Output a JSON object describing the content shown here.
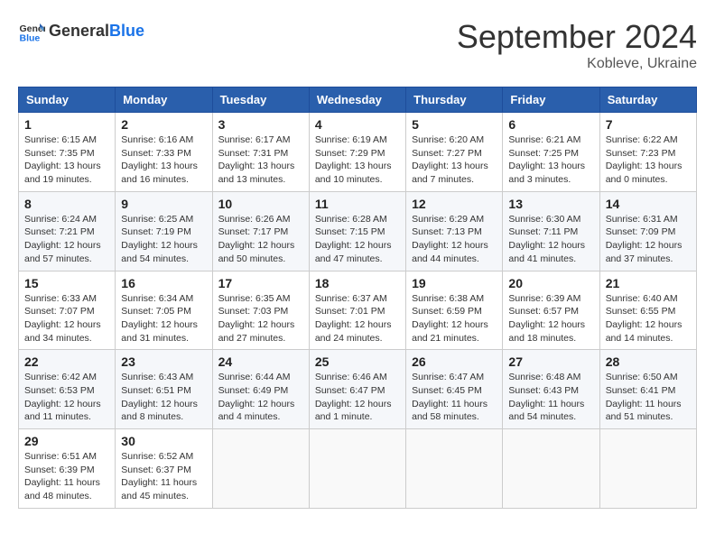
{
  "header": {
    "logo_text_general": "General",
    "logo_text_blue": "Blue",
    "month_title": "September 2024",
    "subtitle": "Kobleve, Ukraine"
  },
  "calendar": {
    "days_of_week": [
      "Sunday",
      "Monday",
      "Tuesday",
      "Wednesday",
      "Thursday",
      "Friday",
      "Saturday"
    ],
    "weeks": [
      [
        {
          "day": "1",
          "sunrise": "6:15 AM",
          "sunset": "7:35 PM",
          "daylight": "13 hours and 19 minutes."
        },
        {
          "day": "2",
          "sunrise": "6:16 AM",
          "sunset": "7:33 PM",
          "daylight": "13 hours and 16 minutes."
        },
        {
          "day": "3",
          "sunrise": "6:17 AM",
          "sunset": "7:31 PM",
          "daylight": "13 hours and 13 minutes."
        },
        {
          "day": "4",
          "sunrise": "6:19 AM",
          "sunset": "7:29 PM",
          "daylight": "13 hours and 10 minutes."
        },
        {
          "day": "5",
          "sunrise": "6:20 AM",
          "sunset": "7:27 PM",
          "daylight": "13 hours and 7 minutes."
        },
        {
          "day": "6",
          "sunrise": "6:21 AM",
          "sunset": "7:25 PM",
          "daylight": "13 hours and 3 minutes."
        },
        {
          "day": "7",
          "sunrise": "6:22 AM",
          "sunset": "7:23 PM",
          "daylight": "13 hours and 0 minutes."
        }
      ],
      [
        {
          "day": "8",
          "sunrise": "6:24 AM",
          "sunset": "7:21 PM",
          "daylight": "12 hours and 57 minutes."
        },
        {
          "day": "9",
          "sunrise": "6:25 AM",
          "sunset": "7:19 PM",
          "daylight": "12 hours and 54 minutes."
        },
        {
          "day": "10",
          "sunrise": "6:26 AM",
          "sunset": "7:17 PM",
          "daylight": "12 hours and 50 minutes."
        },
        {
          "day": "11",
          "sunrise": "6:28 AM",
          "sunset": "7:15 PM",
          "daylight": "12 hours and 47 minutes."
        },
        {
          "day": "12",
          "sunrise": "6:29 AM",
          "sunset": "7:13 PM",
          "daylight": "12 hours and 44 minutes."
        },
        {
          "day": "13",
          "sunrise": "6:30 AM",
          "sunset": "7:11 PM",
          "daylight": "12 hours and 41 minutes."
        },
        {
          "day": "14",
          "sunrise": "6:31 AM",
          "sunset": "7:09 PM",
          "daylight": "12 hours and 37 minutes."
        }
      ],
      [
        {
          "day": "15",
          "sunrise": "6:33 AM",
          "sunset": "7:07 PM",
          "daylight": "12 hours and 34 minutes."
        },
        {
          "day": "16",
          "sunrise": "6:34 AM",
          "sunset": "7:05 PM",
          "daylight": "12 hours and 31 minutes."
        },
        {
          "day": "17",
          "sunrise": "6:35 AM",
          "sunset": "7:03 PM",
          "daylight": "12 hours and 27 minutes."
        },
        {
          "day": "18",
          "sunrise": "6:37 AM",
          "sunset": "7:01 PM",
          "daylight": "12 hours and 24 minutes."
        },
        {
          "day": "19",
          "sunrise": "6:38 AM",
          "sunset": "6:59 PM",
          "daylight": "12 hours and 21 minutes."
        },
        {
          "day": "20",
          "sunrise": "6:39 AM",
          "sunset": "6:57 PM",
          "daylight": "12 hours and 18 minutes."
        },
        {
          "day": "21",
          "sunrise": "6:40 AM",
          "sunset": "6:55 PM",
          "daylight": "12 hours and 14 minutes."
        }
      ],
      [
        {
          "day": "22",
          "sunrise": "6:42 AM",
          "sunset": "6:53 PM",
          "daylight": "12 hours and 11 minutes."
        },
        {
          "day": "23",
          "sunrise": "6:43 AM",
          "sunset": "6:51 PM",
          "daylight": "12 hours and 8 minutes."
        },
        {
          "day": "24",
          "sunrise": "6:44 AM",
          "sunset": "6:49 PM",
          "daylight": "12 hours and 4 minutes."
        },
        {
          "day": "25",
          "sunrise": "6:46 AM",
          "sunset": "6:47 PM",
          "daylight": "12 hours and 1 minute."
        },
        {
          "day": "26",
          "sunrise": "6:47 AM",
          "sunset": "6:45 PM",
          "daylight": "11 hours and 58 minutes."
        },
        {
          "day": "27",
          "sunrise": "6:48 AM",
          "sunset": "6:43 PM",
          "daylight": "11 hours and 54 minutes."
        },
        {
          "day": "28",
          "sunrise": "6:50 AM",
          "sunset": "6:41 PM",
          "daylight": "11 hours and 51 minutes."
        }
      ],
      [
        {
          "day": "29",
          "sunrise": "6:51 AM",
          "sunset": "6:39 PM",
          "daylight": "11 hours and 48 minutes."
        },
        {
          "day": "30",
          "sunrise": "6:52 AM",
          "sunset": "6:37 PM",
          "daylight": "11 hours and 45 minutes."
        },
        null,
        null,
        null,
        null,
        null
      ]
    ]
  }
}
